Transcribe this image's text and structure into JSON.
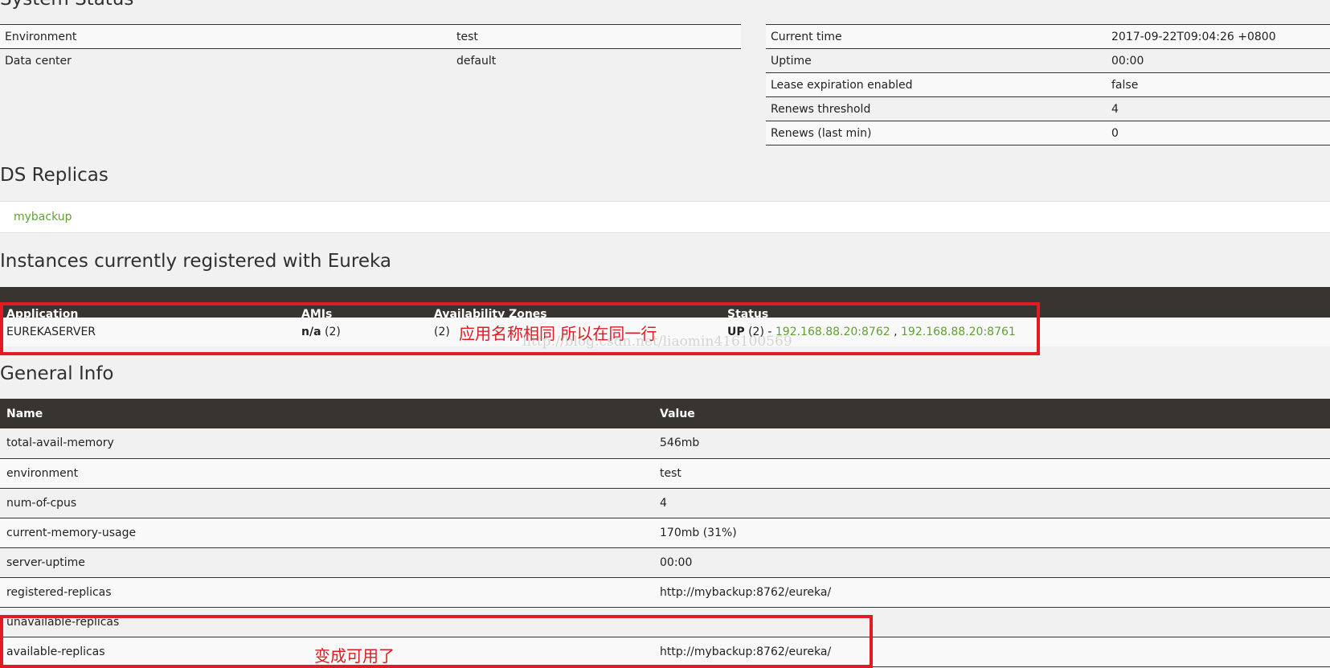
{
  "system_status": {
    "title": "System Status",
    "left": [
      {
        "label": "Environment",
        "value": "test"
      },
      {
        "label": "Data center",
        "value": "default"
      }
    ],
    "right": [
      {
        "label": "Current time",
        "value": "2017-09-22T09:04:26 +0800"
      },
      {
        "label": "Uptime",
        "value": "00:00"
      },
      {
        "label": "Lease expiration enabled",
        "value": "false"
      },
      {
        "label": "Renews threshold",
        "value": "4"
      },
      {
        "label": "Renews (last min)",
        "value": "0"
      }
    ]
  },
  "ds_replicas": {
    "title": "DS Replicas",
    "link": "mybackup"
  },
  "instances": {
    "title": "Instances currently registered with Eureka",
    "headers": [
      "Application",
      "AMIs",
      "Availability Zones",
      "Status"
    ],
    "row": {
      "application": "EUREKASERVER",
      "amis_bold": "n/a",
      "amis_count": " (2)",
      "zones": "(2)",
      "status_bold": "UP",
      "status_count": " (2) - ",
      "link1": "192.168.88.20:8762",
      "separator": " , ",
      "link2": "192.168.88.20:8761"
    }
  },
  "general_info": {
    "title": "General Info",
    "headers": [
      "Name",
      "Value"
    ],
    "rows": [
      {
        "name": "total-avail-memory",
        "value": "546mb"
      },
      {
        "name": "environment",
        "value": "test"
      },
      {
        "name": "num-of-cpus",
        "value": "4"
      },
      {
        "name": "current-memory-usage",
        "value": "170mb (31%)"
      },
      {
        "name": "server-uptime",
        "value": "00:00"
      },
      {
        "name": "registered-replicas",
        "value": "http://mybackup:8762/eureka/"
      },
      {
        "name": "unavailable-replicas",
        "value": ""
      },
      {
        "name": "available-replicas",
        "value": "http://mybackup:8762/eureka/"
      }
    ]
  },
  "annotations": {
    "note1": "应用名称相同 所以在同一行",
    "note2": "变成可用了",
    "watermark": "http://blog.csdn.net/liaomin416100569",
    "color": "#e01b23"
  }
}
